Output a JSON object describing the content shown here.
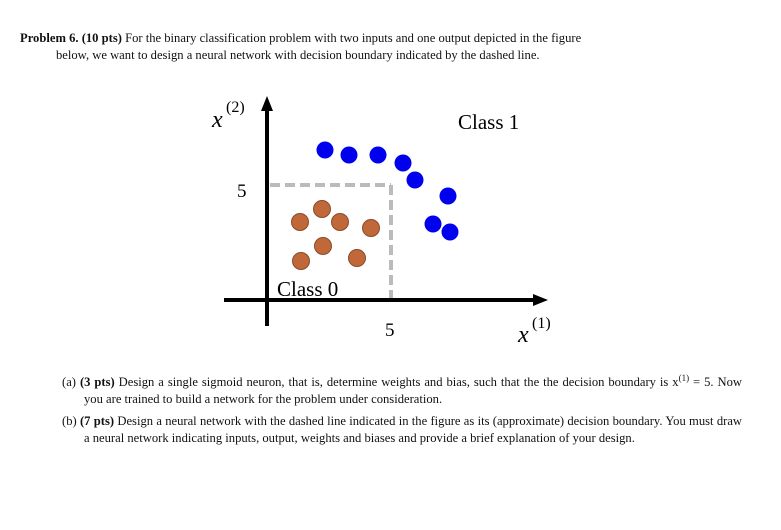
{
  "problem": {
    "label": "Problem 6.",
    "points": "(10 pts)",
    "text_line1": "For the binary classification problem with two inputs and one output depicted in the figure",
    "text_line2": "below, we want to design a neural network with decision boundary indicated by the dashed line."
  },
  "figure": {
    "y_axis_label": "x",
    "y_axis_sup": "(2)",
    "x_axis_label": "x",
    "x_axis_sup": "(1)",
    "y_tick": "5",
    "x_tick": "5",
    "class1_label": "Class 1",
    "class0_label": "Class 0",
    "class1_color": "#0000ee",
    "class0_color": "#c0683a",
    "boundary_color": "#bbbbbb"
  },
  "parts": [
    {
      "label": "(a)",
      "points": "(3 pts)",
      "text_pre": "Design a single sigmoid neuron, that is, determine weights and bias, such that the the decision boundary is x",
      "sup": "(1)",
      "text_post": " = 5. Now you are trained to build a network for the problem under consideration."
    },
    {
      "label": "(b)",
      "points": "(7 pts)",
      "text": "Design a neural network with the dashed line indicated in the figure as its (approximate) decision boundary. You must draw a neural network indicating inputs, output, weights and biases and provide a brief explanation of your design."
    }
  ]
}
